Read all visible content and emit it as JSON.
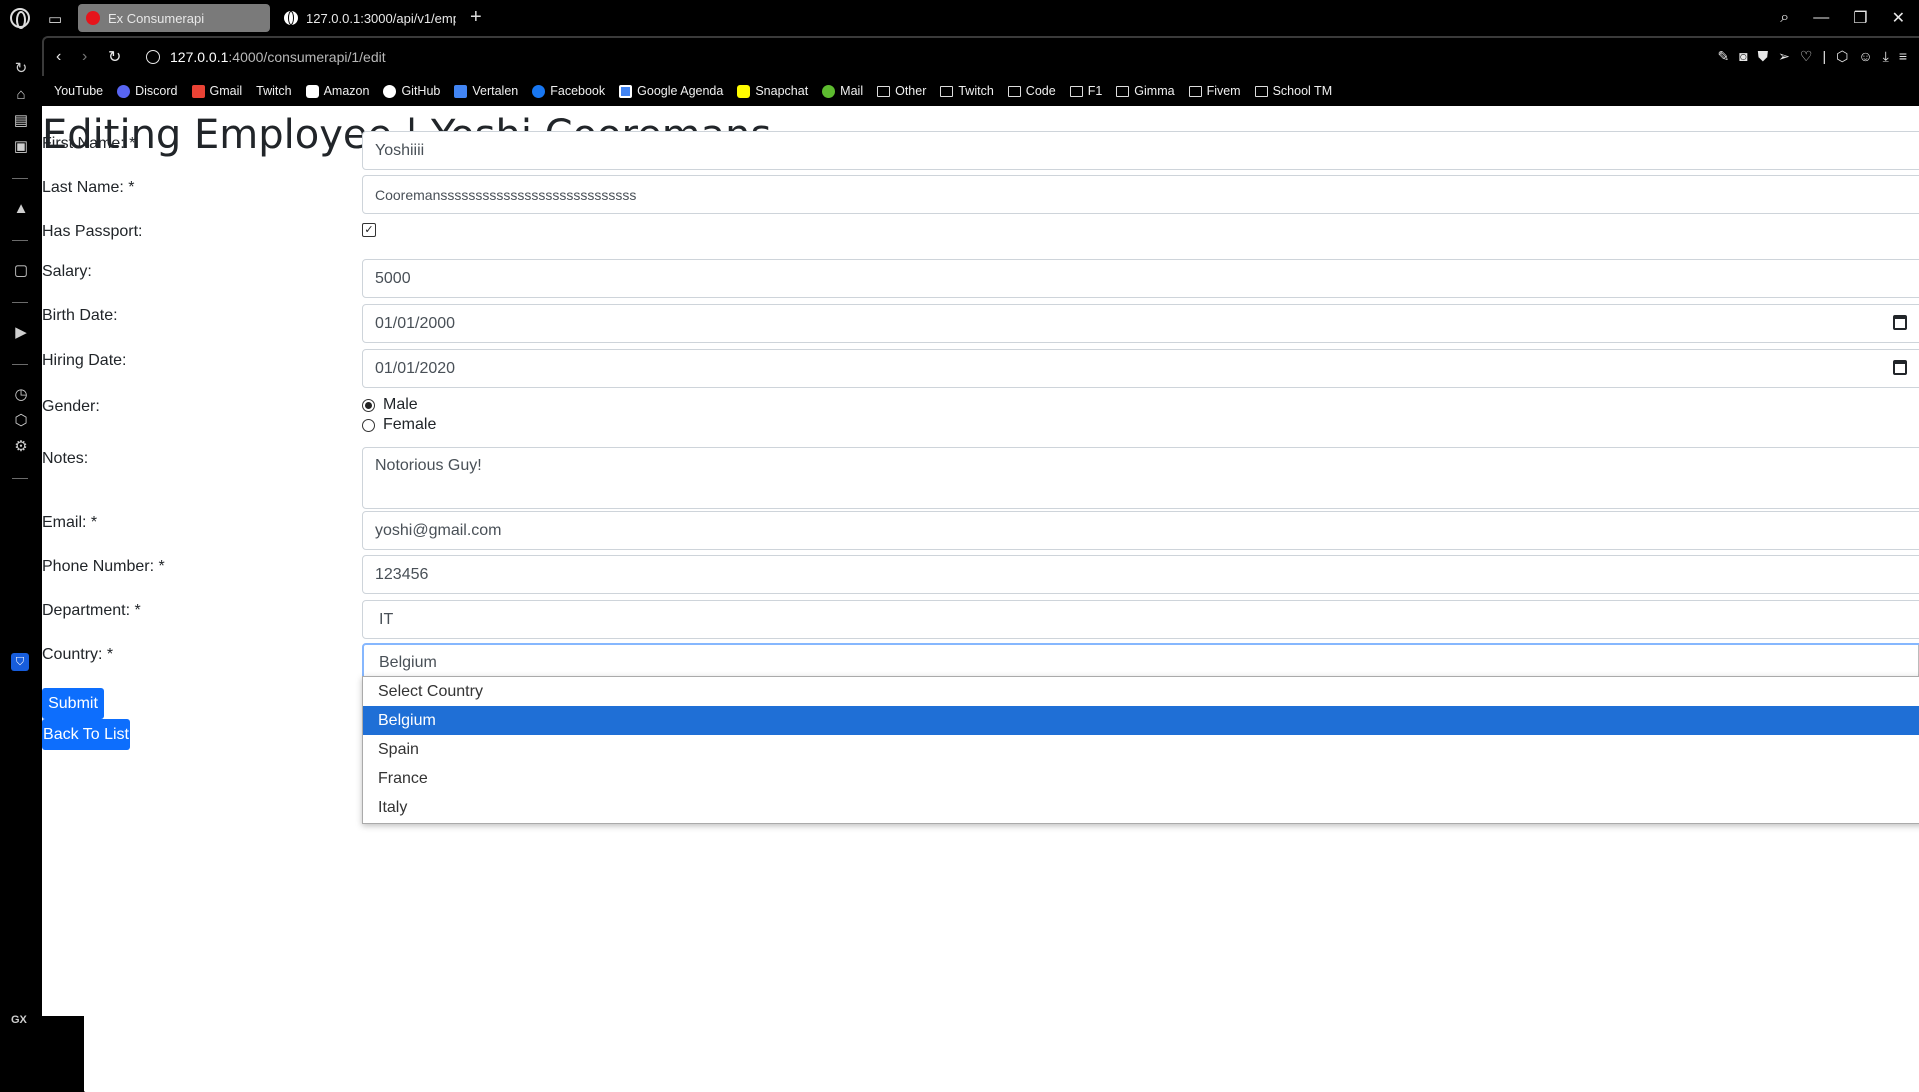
{
  "browser": {
    "tabs": [
      {
        "label": "Ex Consumerapi",
        "active": true
      },
      {
        "label": "127.0.0.1:3000/api/v1/emp",
        "active": false
      }
    ],
    "url": {
      "host": "127.0.0.1",
      "path": ":4000/consumerapi/1/edit"
    },
    "bookmarks": [
      {
        "label": "YouTube",
        "icon": "page-icon"
      },
      {
        "label": "Discord",
        "icon": "discord-icon"
      },
      {
        "label": "Gmail",
        "icon": "gmail-icon"
      },
      {
        "label": "Twitch",
        "icon": "page-icon"
      },
      {
        "label": "Amazon",
        "icon": "amazon-icon"
      },
      {
        "label": "GitHub",
        "icon": "github-icon"
      },
      {
        "label": "Vertalen",
        "icon": "translate-icon"
      },
      {
        "label": "Facebook",
        "icon": "facebook-icon"
      },
      {
        "label": "Google Agenda",
        "icon": "calendar-icon"
      },
      {
        "label": "Snapchat",
        "icon": "snapchat-icon"
      },
      {
        "label": "Mail",
        "icon": "mail-icon"
      },
      {
        "label": "Other",
        "icon": "folder-icon"
      },
      {
        "label": "Twitch",
        "icon": "folder-icon"
      },
      {
        "label": "Code",
        "icon": "folder-icon"
      },
      {
        "label": "F1",
        "icon": "folder-icon"
      },
      {
        "label": "Gimma",
        "icon": "folder-icon"
      },
      {
        "label": "Fivem",
        "icon": "folder-icon"
      },
      {
        "label": "School TM",
        "icon": "folder-icon"
      }
    ],
    "sidebar_badge": "GX"
  },
  "page": {
    "title": "Editing Employee | Yoshi Cooremans",
    "labels": {
      "first_name": "First Name: *",
      "last_name": "Last Name: *",
      "has_passport": "Has Passport:",
      "salary": "Salary:",
      "birth_date": "Birth Date:",
      "hiring_date": "Hiring Date:",
      "gender": "Gender:",
      "notes": "Notes:",
      "email": "Email: *",
      "phone": "Phone Number: *",
      "department": "Department: *",
      "country": "Country: *"
    },
    "values": {
      "first_name": "Yoshiiii",
      "last_name": "Cooremanssssssssssssssssssssssssssss",
      "has_passport": true,
      "salary": "5000",
      "birth_date": "01/01/2000",
      "hiring_date": "01/01/2020",
      "gender_options": [
        "Male",
        "Female"
      ],
      "gender_selected": "Male",
      "notes": "Notorious Guy!",
      "email": "yoshi@gmail.com",
      "phone": "123456",
      "department": "IT",
      "country": "Belgium"
    },
    "country_options": [
      "Select Country",
      "Belgium",
      "Spain",
      "France",
      "Italy"
    ],
    "buttons": {
      "submit": "Submit",
      "back": "Back To List"
    },
    "colors": {
      "primary": "#0d6efd",
      "selected_option": "#1f6fd6",
      "focus_border": "#86b7fe"
    }
  }
}
